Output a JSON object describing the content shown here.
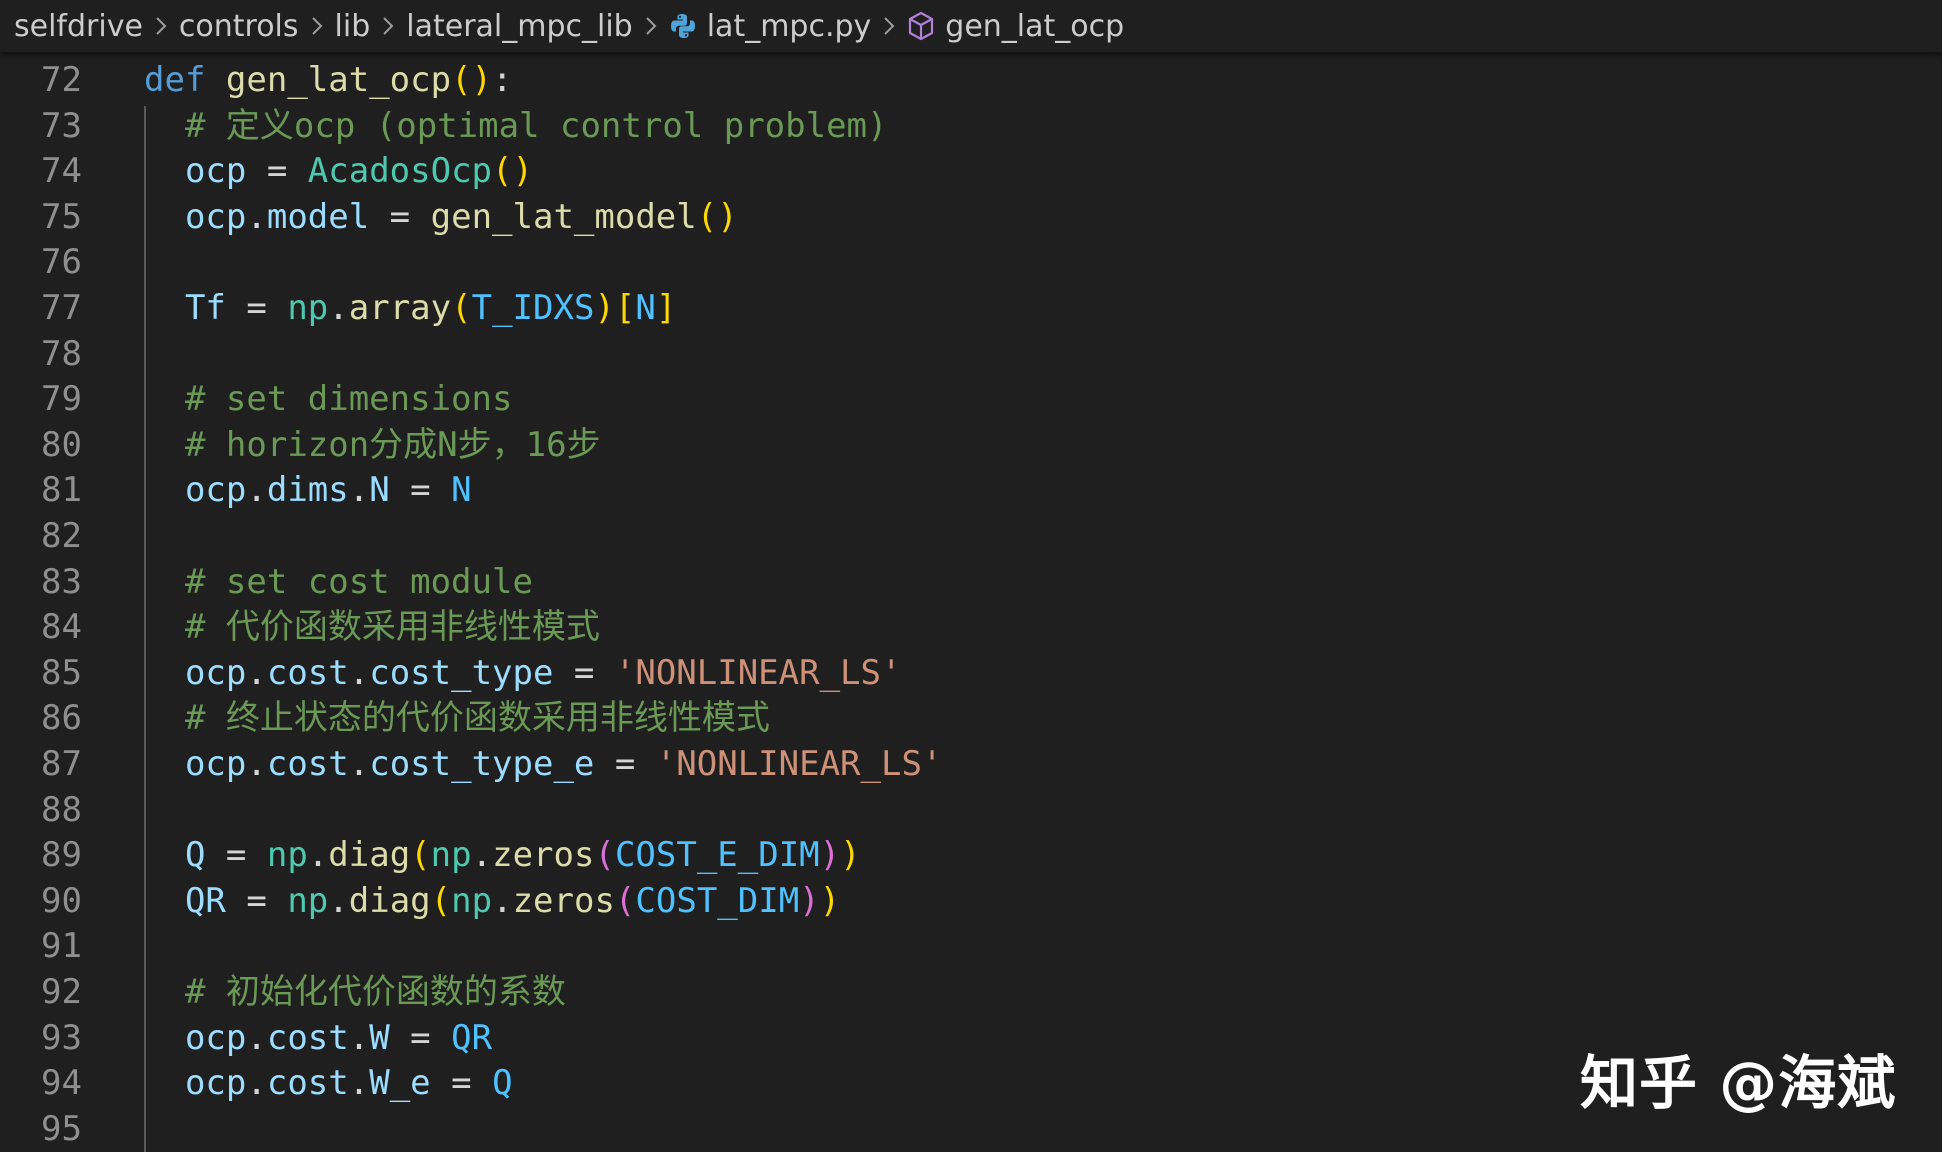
{
  "breadcrumb": {
    "items": [
      "selfdrive",
      "controls",
      "lib",
      "lateral_mpc_lib",
      "lat_mpc.py",
      "gen_lat_ocp"
    ],
    "file_icon": "python-icon",
    "symbol_icon": "cube-icon",
    "separator_icon": "chevron-right-icon"
  },
  "editor": {
    "lines": [
      {
        "num": "72",
        "t": [
          {
            "c": "kw",
            "v": "def"
          },
          {
            "c": "op",
            "v": " "
          },
          {
            "c": "fn",
            "v": "gen_lat_ocp"
          },
          {
            "c": "p1",
            "v": "()"
          },
          {
            "c": "op",
            "v": ":"
          }
        ]
      },
      {
        "num": "73",
        "t": [
          {
            "c": "com",
            "v": "  # 定义ocp (optimal control problem)"
          }
        ]
      },
      {
        "num": "74",
        "t": [
          {
            "c": "var",
            "v": "  ocp"
          },
          {
            "c": "op",
            "v": " = "
          },
          {
            "c": "cls",
            "v": "AcadosOcp"
          },
          {
            "c": "p1",
            "v": "()"
          }
        ]
      },
      {
        "num": "75",
        "t": [
          {
            "c": "var",
            "v": "  ocp"
          },
          {
            "c": "op",
            "v": "."
          },
          {
            "c": "var",
            "v": "model"
          },
          {
            "c": "op",
            "v": " = "
          },
          {
            "c": "fn",
            "v": "gen_lat_model"
          },
          {
            "c": "p1",
            "v": "()"
          }
        ]
      },
      {
        "num": "76",
        "t": []
      },
      {
        "num": "77",
        "t": [
          {
            "c": "var",
            "v": "  Tf"
          },
          {
            "c": "op",
            "v": " = "
          },
          {
            "c": "cls",
            "v": "np"
          },
          {
            "c": "op",
            "v": "."
          },
          {
            "c": "fn",
            "v": "array"
          },
          {
            "c": "p1",
            "v": "("
          },
          {
            "c": "const",
            "v": "T_IDXS"
          },
          {
            "c": "p1",
            "v": ")["
          },
          {
            "c": "const",
            "v": "N"
          },
          {
            "c": "p1",
            "v": "]"
          }
        ]
      },
      {
        "num": "78",
        "t": []
      },
      {
        "num": "79",
        "t": [
          {
            "c": "com",
            "v": "  # set dimensions"
          }
        ]
      },
      {
        "num": "80",
        "t": [
          {
            "c": "com",
            "v": "  # horizon分成N步，16步"
          }
        ]
      },
      {
        "num": "81",
        "t": [
          {
            "c": "var",
            "v": "  ocp"
          },
          {
            "c": "op",
            "v": "."
          },
          {
            "c": "var",
            "v": "dims"
          },
          {
            "c": "op",
            "v": "."
          },
          {
            "c": "var",
            "v": "N"
          },
          {
            "c": "op",
            "v": " = "
          },
          {
            "c": "const",
            "v": "N"
          }
        ]
      },
      {
        "num": "82",
        "t": []
      },
      {
        "num": "83",
        "t": [
          {
            "c": "com",
            "v": "  # set cost module"
          }
        ]
      },
      {
        "num": "84",
        "t": [
          {
            "c": "com",
            "v": "  # 代价函数采用非线性模式"
          }
        ]
      },
      {
        "num": "85",
        "t": [
          {
            "c": "var",
            "v": "  ocp"
          },
          {
            "c": "op",
            "v": "."
          },
          {
            "c": "var",
            "v": "cost"
          },
          {
            "c": "op",
            "v": "."
          },
          {
            "c": "var",
            "v": "cost_type"
          },
          {
            "c": "op",
            "v": " = "
          },
          {
            "c": "str",
            "v": "'NONLINEAR_LS'"
          }
        ]
      },
      {
        "num": "86",
        "t": [
          {
            "c": "com",
            "v": "  # 终止状态的代价函数采用非线性模式"
          }
        ]
      },
      {
        "num": "87",
        "t": [
          {
            "c": "var",
            "v": "  ocp"
          },
          {
            "c": "op",
            "v": "."
          },
          {
            "c": "var",
            "v": "cost"
          },
          {
            "c": "op",
            "v": "."
          },
          {
            "c": "var",
            "v": "cost_type_e"
          },
          {
            "c": "op",
            "v": " = "
          },
          {
            "c": "str",
            "v": "'NONLINEAR_LS'"
          }
        ]
      },
      {
        "num": "88",
        "t": []
      },
      {
        "num": "89",
        "t": [
          {
            "c": "var",
            "v": "  Q"
          },
          {
            "c": "op",
            "v": " = "
          },
          {
            "c": "cls",
            "v": "np"
          },
          {
            "c": "op",
            "v": "."
          },
          {
            "c": "fn",
            "v": "diag"
          },
          {
            "c": "p1",
            "v": "("
          },
          {
            "c": "cls",
            "v": "np"
          },
          {
            "c": "op",
            "v": "."
          },
          {
            "c": "fn",
            "v": "zeros"
          },
          {
            "c": "p2",
            "v": "("
          },
          {
            "c": "const",
            "v": "COST_E_DIM"
          },
          {
            "c": "p2",
            "v": ")"
          },
          {
            "c": "p1",
            "v": ")"
          }
        ]
      },
      {
        "num": "90",
        "t": [
          {
            "c": "var",
            "v": "  QR"
          },
          {
            "c": "op",
            "v": " = "
          },
          {
            "c": "cls",
            "v": "np"
          },
          {
            "c": "op",
            "v": "."
          },
          {
            "c": "fn",
            "v": "diag"
          },
          {
            "c": "p1",
            "v": "("
          },
          {
            "c": "cls",
            "v": "np"
          },
          {
            "c": "op",
            "v": "."
          },
          {
            "c": "fn",
            "v": "zeros"
          },
          {
            "c": "p2",
            "v": "("
          },
          {
            "c": "const",
            "v": "COST_DIM"
          },
          {
            "c": "p2",
            "v": ")"
          },
          {
            "c": "p1",
            "v": ")"
          }
        ]
      },
      {
        "num": "91",
        "t": []
      },
      {
        "num": "92",
        "t": [
          {
            "c": "com",
            "v": "  # 初始化代价函数的系数"
          }
        ]
      },
      {
        "num": "93",
        "t": [
          {
            "c": "var",
            "v": "  ocp"
          },
          {
            "c": "op",
            "v": "."
          },
          {
            "c": "var",
            "v": "cost"
          },
          {
            "c": "op",
            "v": "."
          },
          {
            "c": "var",
            "v": "W"
          },
          {
            "c": "op",
            "v": " = "
          },
          {
            "c": "const",
            "v": "QR"
          }
        ]
      },
      {
        "num": "94",
        "t": [
          {
            "c": "var",
            "v": "  ocp"
          },
          {
            "c": "op",
            "v": "."
          },
          {
            "c": "var",
            "v": "cost"
          },
          {
            "c": "op",
            "v": "."
          },
          {
            "c": "var",
            "v": "W_e"
          },
          {
            "c": "op",
            "v": " = "
          },
          {
            "c": "const",
            "v": "Q"
          }
        ]
      },
      {
        "num": "95",
        "t": []
      }
    ]
  },
  "watermark": "知乎 @海斌"
}
